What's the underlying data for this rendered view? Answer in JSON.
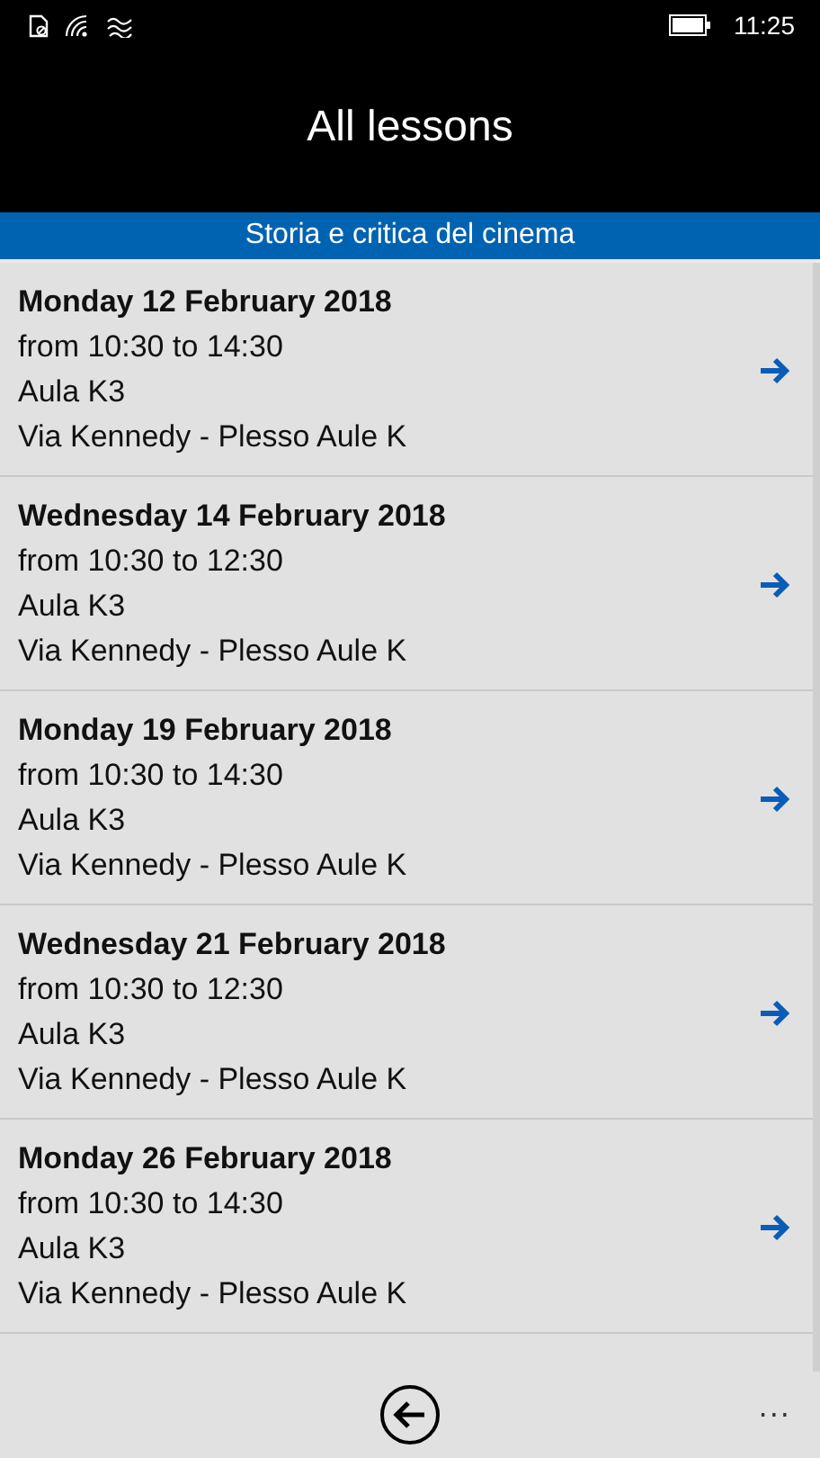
{
  "status_bar": {
    "time": "11:25"
  },
  "header": {
    "title": "All lessons"
  },
  "course_band": {
    "title": "Storia e critica del cinema"
  },
  "lessons": [
    {
      "date": "Monday 12 February 2018",
      "time": "from 10:30 to 14:30",
      "room": "Aula K3",
      "place": "Via Kennedy - Plesso Aule K"
    },
    {
      "date": "Wednesday 14 February 2018",
      "time": "from 10:30 to 12:30",
      "room": "Aula K3",
      "place": "Via Kennedy - Plesso Aule K"
    },
    {
      "date": "Monday 19 February 2018",
      "time": "from 10:30 to 14:30",
      "room": "Aula K3",
      "place": "Via Kennedy - Plesso Aule K"
    },
    {
      "date": "Wednesday 21 February 2018",
      "time": "from 10:30 to 12:30",
      "room": "Aula K3",
      "place": "Via Kennedy - Plesso Aule K"
    },
    {
      "date": "Monday 26 February 2018",
      "time": "from 10:30 to 14:30",
      "room": "Aula K3",
      "place": "Via Kennedy - Plesso Aule K"
    }
  ],
  "app_bar": {
    "more": "..."
  }
}
